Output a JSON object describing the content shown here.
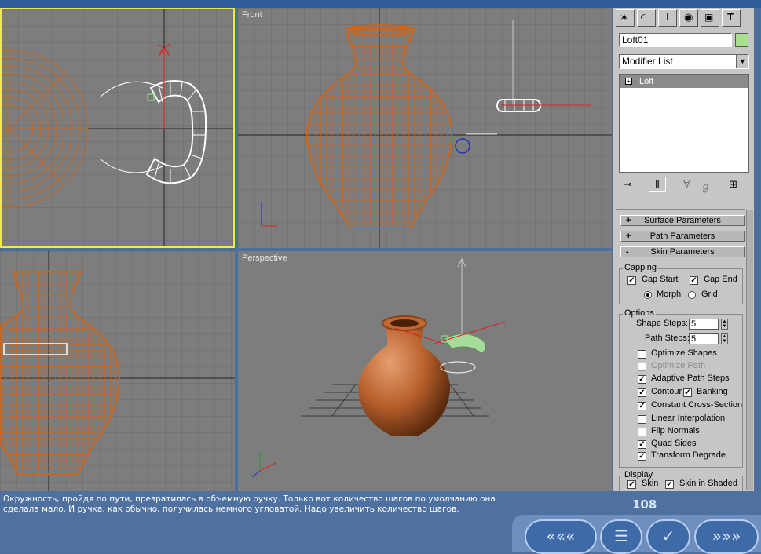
{
  "viewports": {
    "front_label": "Front",
    "perspective_label": "Perspective"
  },
  "panel": {
    "object_name": "Loft01",
    "object_color": "#a8e08e",
    "modifier_list_label": "Modifier List",
    "stack_item": "Loft",
    "rollouts": {
      "surface": {
        "sign": "+",
        "label": "Surface Parameters"
      },
      "path": {
        "sign": "+",
        "label": "Path Parameters"
      },
      "skin": {
        "sign": "-",
        "label": "Skin Parameters"
      }
    },
    "capping": {
      "title": "Capping",
      "cap_start": "Cap Start",
      "cap_end": "Cap End",
      "morph": "Morph",
      "grid": "Grid"
    },
    "options": {
      "title": "Options",
      "shape_steps_label": "Shape Steps:",
      "shape_steps_value": "5",
      "path_steps_label": "Path Steps:",
      "path_steps_value": "5",
      "optimize_shapes": "Optimize Shapes",
      "optimize_path": "Optimize Path",
      "adaptive_path_steps": "Adaptive Path Steps",
      "contour": "Contour",
      "banking": "Banking",
      "constant_cross_section": "Constant Cross-Section",
      "linear_interpolation": "Linear Interpolation",
      "flip_normals": "Flip Normals",
      "quad_sides": "Quad Sides",
      "transform_degrade": "Transform Degrade"
    },
    "display": {
      "title": "Display",
      "skin": "Skin",
      "skin_in_shaded": "Skin in Shaded"
    }
  },
  "status": {
    "text": "Окружность, пройдя по пути, превратилась в объемную ручку. Только вот количество шагов по умолчанию она сделала мало. И ручка, как обычно, получилась немного угловатой. Надо увеличить количество шагов.",
    "page_number": "108"
  },
  "colors": {
    "viewport_bg": "#7d7d7d",
    "wire_orange": "#c8651f",
    "active_border": "#f2e84a",
    "panel_bg": "#c6c6c6",
    "status_bg": "#4e71a0"
  }
}
